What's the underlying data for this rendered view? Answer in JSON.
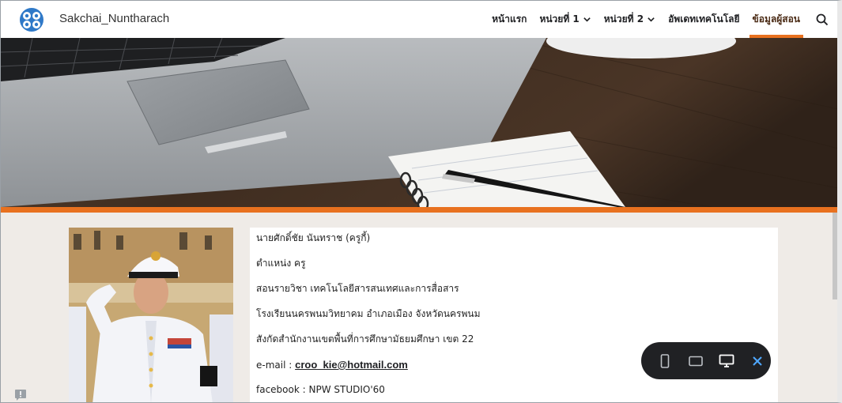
{
  "header": {
    "site_title": "Sakchai_Nuntharach",
    "nav": [
      {
        "label": "หน้าแรก",
        "has_dropdown": false,
        "active": false
      },
      {
        "label": "หน่วยที่ 1",
        "has_dropdown": true,
        "active": false
      },
      {
        "label": "หน่วยที่ 2",
        "has_dropdown": true,
        "active": false
      },
      {
        "label": "อัพเดทเทคโนโลยี",
        "has_dropdown": false,
        "active": false
      },
      {
        "label": "ข้อมูลผู้สอน",
        "has_dropdown": false,
        "active": true
      }
    ],
    "search_icon": "search-icon"
  },
  "colors": {
    "accent": "#e8711f",
    "toolbar_bg": "#202124",
    "close_x": "#4fa8ff"
  },
  "profile": {
    "name": "นายศักดิ์ชัย  นันทราช (ครูกี้)",
    "position": "ตำแหน่ง ครู",
    "subject": "สอนรายวิชา เทคโนโลยีสารสนเทศและการสื่อสาร",
    "school": "โรงเรียนนครพนมวิทยาคม อำเภอเมือง จังหวัดนครพนม",
    "affiliation": "สังกัดสำนักงานเขตพื้นที่การศึกษามัธยมศึกษา เขต 22",
    "email_label": "e-mail : ",
    "email": "croo_kie@hotmail.com",
    "facebook": "facebook : NPW STUDIO'60"
  },
  "preview_toolbar": {
    "icons": [
      "phone-icon",
      "tablet-icon",
      "desktop-icon",
      "close-icon"
    ]
  }
}
